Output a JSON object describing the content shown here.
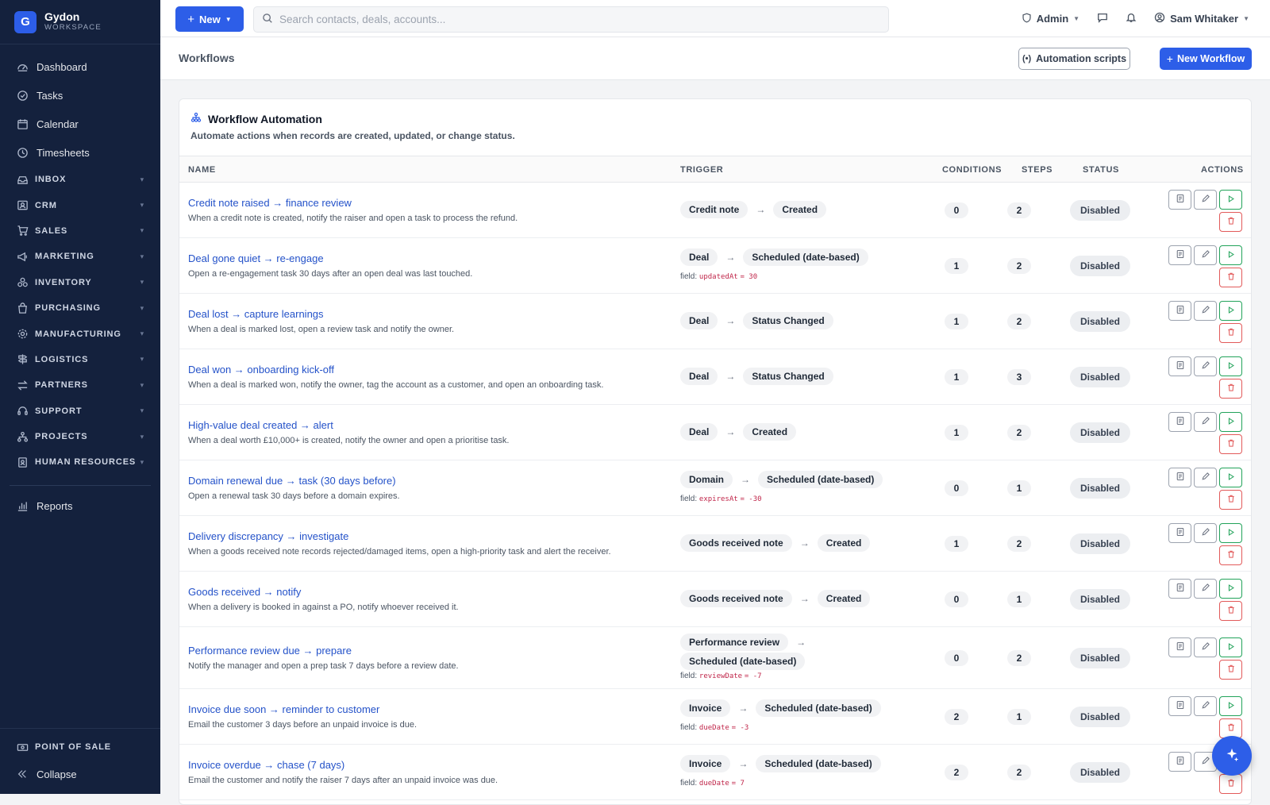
{
  "brand": {
    "initial": "G",
    "name": "Gydon",
    "sub": "WORKSPACE"
  },
  "sidebar": {
    "main": [
      {
        "label": "Dashboard",
        "icon": "dashboard-icon"
      },
      {
        "label": "Tasks",
        "icon": "check-circle-icon"
      },
      {
        "label": "Calendar",
        "icon": "calendar-icon"
      },
      {
        "label": "Timesheets",
        "icon": "clock-icon"
      }
    ],
    "groups": [
      {
        "label": "INBOX",
        "icon": "inbox-icon"
      },
      {
        "label": "CRM",
        "icon": "contact-card-icon"
      },
      {
        "label": "SALES",
        "icon": "cart-icon"
      },
      {
        "label": "MARKETING",
        "icon": "megaphone-icon"
      },
      {
        "label": "INVENTORY",
        "icon": "boxes-icon"
      },
      {
        "label": "PURCHASING",
        "icon": "bag-icon"
      },
      {
        "label": "MANUFACTURING",
        "icon": "gear-icon"
      },
      {
        "label": "LOGISTICS",
        "icon": "signpost-icon"
      },
      {
        "label": "PARTNERS",
        "icon": "exchange-icon"
      },
      {
        "label": "SUPPORT",
        "icon": "headset-icon"
      },
      {
        "label": "PROJECTS",
        "icon": "hierarchy-icon"
      },
      {
        "label": "HUMAN RESOURCES",
        "icon": "badge-icon"
      }
    ],
    "reports": "Reports",
    "pos": "POINT OF SALE",
    "collapse": "Collapse"
  },
  "topbar": {
    "new_label": "New",
    "search_placeholder": "Search contacts, deals, accounts...",
    "role": "Admin",
    "user": "Sam Whitaker"
  },
  "page": {
    "title": "Workflows",
    "scripts_label": "Automation scripts",
    "new_workflow_label": "New Workflow"
  },
  "card": {
    "title": "Workflow Automation",
    "subtitle": "Automate actions when records are created, updated, or change status."
  },
  "columns": {
    "name": "NAME",
    "trigger": "TRIGGER",
    "conditions": "CONDITIONS",
    "steps": "STEPS",
    "status": "STATUS",
    "actions": "ACTIONS"
  },
  "rows": [
    {
      "name": "Credit note raised → finance review",
      "desc": "When a credit note is created, notify the raiser and open a task to process the refund.",
      "entity": "Credit note",
      "event": "Created",
      "field": null,
      "conditions": "0",
      "steps": "2",
      "status": "Disabled"
    },
    {
      "name": "Deal gone quiet → re-engage",
      "desc": "Open a re-engagement task 30 days after an open deal was last touched.",
      "entity": "Deal",
      "event": "Scheduled (date-based)",
      "field": {
        "label": "field:",
        "key": "updatedAt",
        "eq": "= 30"
      },
      "conditions": "1",
      "steps": "2",
      "status": "Disabled"
    },
    {
      "name": "Deal lost → capture learnings",
      "desc": "When a deal is marked lost, open a review task and notify the owner.",
      "entity": "Deal",
      "event": "Status Changed",
      "field": null,
      "conditions": "1",
      "steps": "2",
      "status": "Disabled"
    },
    {
      "name": "Deal won → onboarding kick-off",
      "desc": "When a deal is marked won, notify the owner, tag the account as a customer, and open an onboarding task.",
      "entity": "Deal",
      "event": "Status Changed",
      "field": null,
      "conditions": "1",
      "steps": "3",
      "status": "Disabled"
    },
    {
      "name": "High-value deal created → alert",
      "desc": "When a deal worth £10,000+ is created, notify the owner and open a prioritise task.",
      "entity": "Deal",
      "event": "Created",
      "field": null,
      "conditions": "1",
      "steps": "2",
      "status": "Disabled"
    },
    {
      "name": "Domain renewal due → task (30 days before)",
      "desc": "Open a renewal task 30 days before a domain expires.",
      "entity": "Domain",
      "event": "Scheduled (date-based)",
      "field": {
        "label": "field:",
        "key": "expiresAt",
        "eq": "= -30"
      },
      "conditions": "0",
      "steps": "1",
      "status": "Disabled"
    },
    {
      "name": "Delivery discrepancy → investigate",
      "desc": "When a goods received note records rejected/damaged items, open a high-priority task and alert the receiver.",
      "entity": "Goods received note",
      "event": "Created",
      "field": null,
      "conditions": "1",
      "steps": "2",
      "status": "Disabled"
    },
    {
      "name": "Goods received → notify",
      "desc": "When a delivery is booked in against a PO, notify whoever received it.",
      "entity": "Goods received note",
      "event": "Created",
      "field": null,
      "conditions": "0",
      "steps": "1",
      "status": "Disabled"
    },
    {
      "name": "Performance review due → prepare",
      "desc": "Notify the manager and open a prep task 7 days before a review date.",
      "entity": "Performance review",
      "event": "Scheduled (date-based)",
      "field": {
        "label": "field:",
        "key": "reviewDate",
        "eq": "= -7"
      },
      "conditions": "0",
      "steps": "2",
      "status": "Disabled"
    },
    {
      "name": "Invoice due soon → reminder to customer",
      "desc": "Email the customer 3 days before an unpaid invoice is due.",
      "entity": "Invoice",
      "event": "Scheduled (date-based)",
      "field": {
        "label": "field:",
        "key": "dueDate",
        "eq": "= -3"
      },
      "conditions": "2",
      "steps": "1",
      "status": "Disabled"
    },
    {
      "name": "Invoice overdue → chase (7 days)",
      "desc": "Email the customer and notify the raiser 7 days after an unpaid invoice was due.",
      "entity": "Invoice",
      "event": "Scheduled (date-based)",
      "field": {
        "label": "field:",
        "key": "dueDate",
        "eq": "= 7"
      },
      "conditions": "2",
      "steps": "2",
      "status": "Disabled"
    }
  ],
  "colors": {
    "accent": "#2d5ee8",
    "sidebar": "#14213d",
    "link": "#2452c9",
    "run": "#22a35a",
    "delete": "#e25a5a"
  }
}
